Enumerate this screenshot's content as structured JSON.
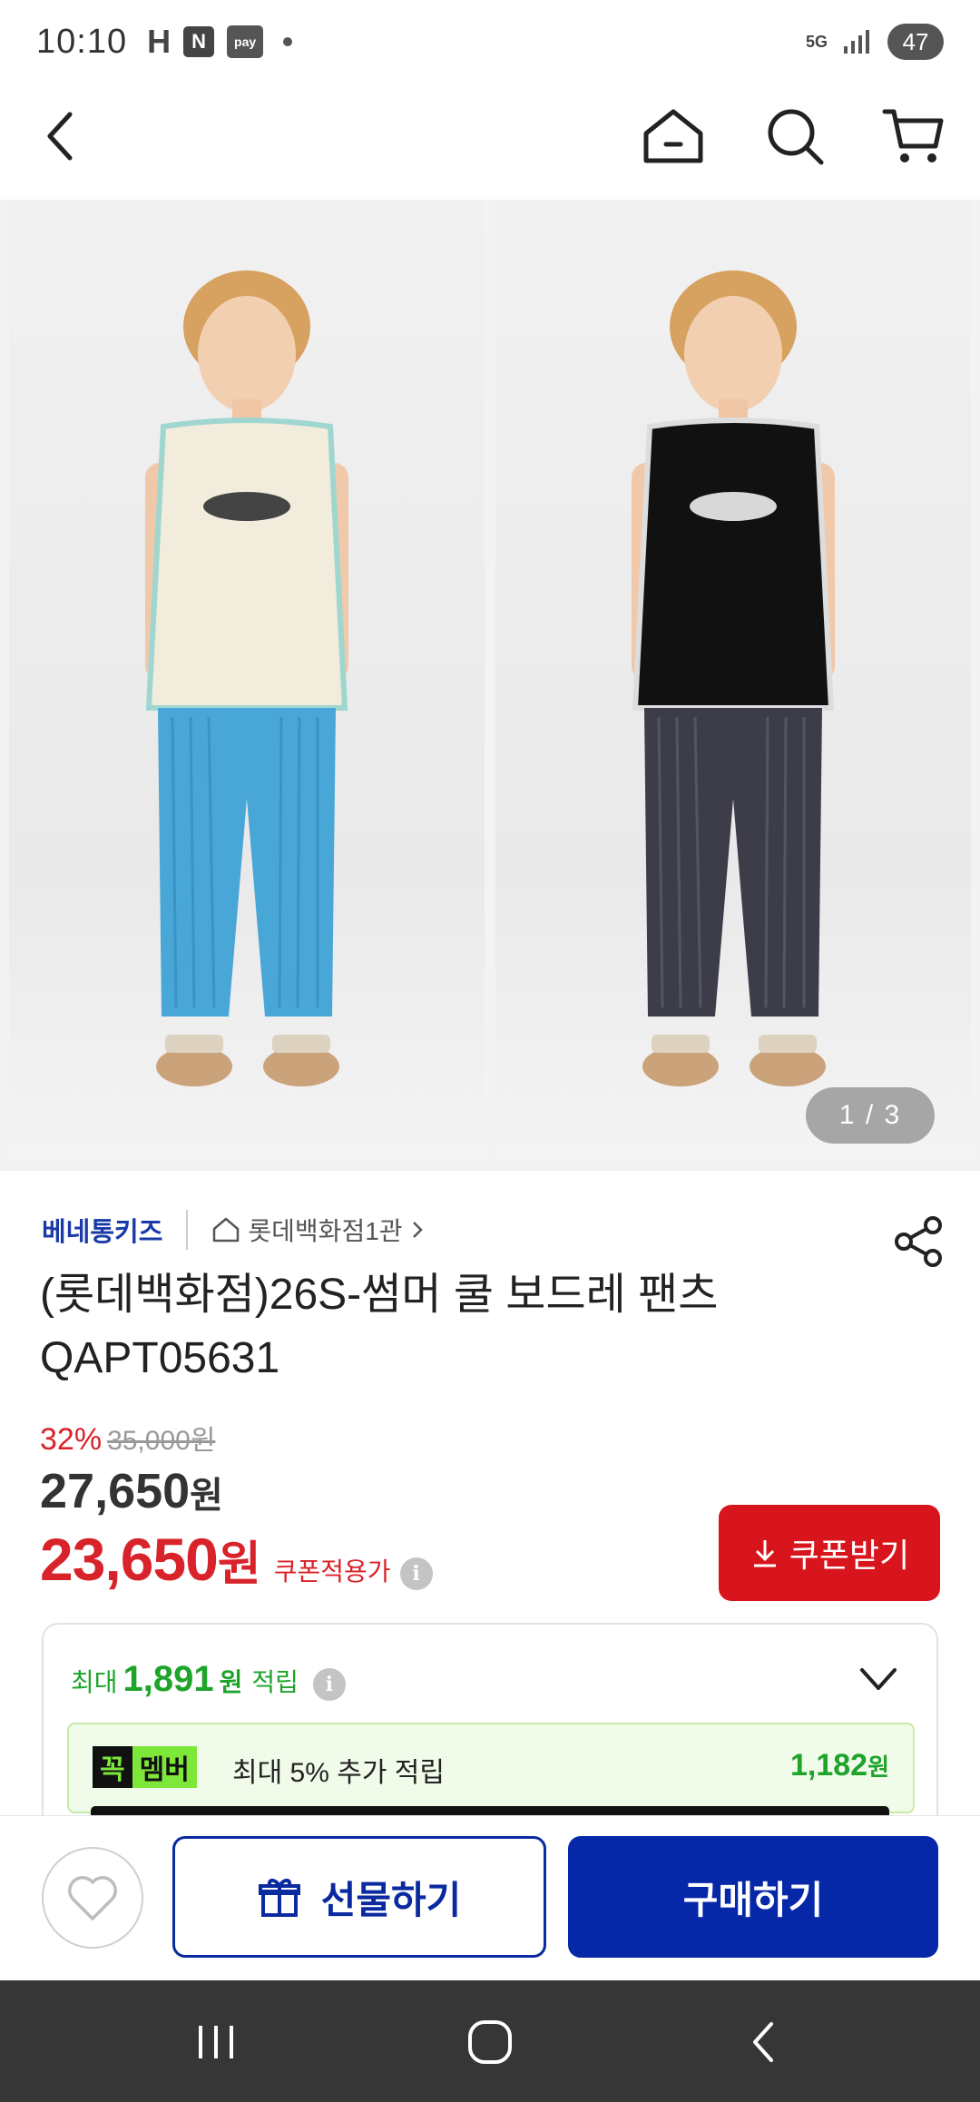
{
  "status_bar": {
    "time": "10:10",
    "icon_h": "H",
    "icon_n": "N",
    "icon_pay": "pay",
    "network": "5G",
    "battery": "47"
  },
  "nav": {
    "back_icon": "back-arrow-icon",
    "home_icon": "home-icon",
    "search_icon": "search-icon",
    "cart_icon": "cart-icon"
  },
  "gallery": {
    "pager": "1 / 3",
    "images": [
      "child-cream-top-blue-pants",
      "child-black-top-charcoal-pants"
    ]
  },
  "product": {
    "brand": "베네통키즈",
    "store": "롯데백화점1관",
    "title_line1": "(롯데백화점)26S-썸머 쿨 보드레 팬츠",
    "title_line2": "QAPT05631",
    "discount": "32%",
    "original_price": "35,000원",
    "price": "27,650",
    "price_unit": "원",
    "coupon_price": "23,650",
    "coupon_price_unit": "원",
    "coupon_label": "쿠폰적용가",
    "coupon_button": "쿠폰받기"
  },
  "points": {
    "prefix": "최대",
    "amount": "1,891",
    "unit": "원",
    "suffix": "적립",
    "member_badge_a": "꼭",
    "member_badge_b": "멤버",
    "member_text": "최대 5% 추가 적립",
    "member_amount": "1,182",
    "member_unit": "원"
  },
  "actions": {
    "gift_label": "선물하기",
    "buy_label": "구매하기"
  },
  "colors": {
    "accent_red": "#d8151c",
    "brand_blue": "#0628a8",
    "points_green": "#1ea42a"
  }
}
